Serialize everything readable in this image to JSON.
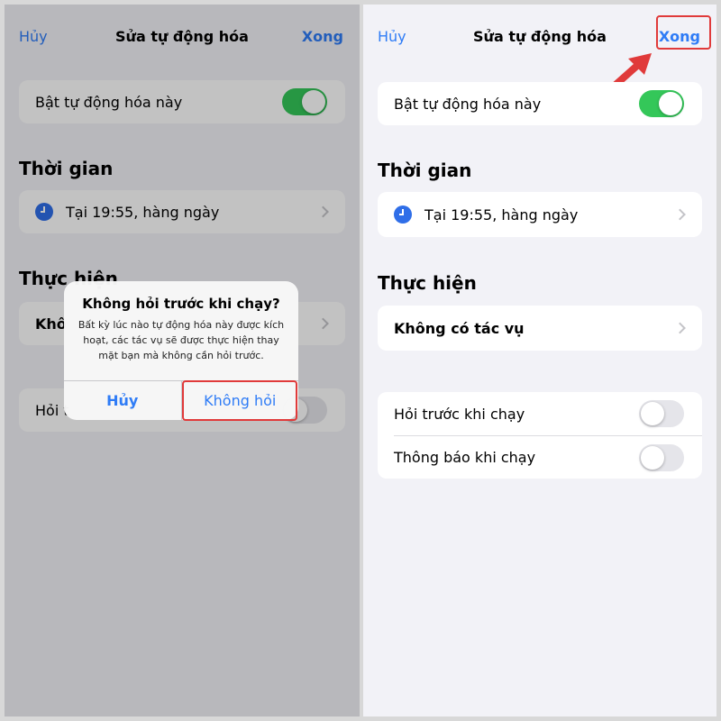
{
  "nav": {
    "cancel": "Hủy",
    "title": "Sửa tự động hóa",
    "done": "Xong"
  },
  "enable_row": {
    "label": "Bật tự động hóa này",
    "enabled": true
  },
  "time_section": {
    "title": "Thời gian",
    "trigger": "Tại 19:55, hàng ngày"
  },
  "action_section": {
    "title": "Thực hiện",
    "left_action_partial": "Khô",
    "no_action": "Không có tác vụ"
  },
  "options": {
    "ask_before_running": "Hỏi trước khi chạy",
    "ask_partial": "Hỏi t",
    "notify_when_run": "Thông báo khi chạy",
    "ask_enabled": false,
    "notify_enabled": false
  },
  "alert": {
    "title": "Không hỏi trước khi chạy?",
    "message": "Bất kỳ lúc nào tự động hóa này được kích hoạt, các tác vụ sẽ được thực hiện thay mặt bạn mà không cần hỏi trước.",
    "cancel": "Hủy",
    "confirm": "Không hỏi"
  },
  "colors": {
    "accent": "#2f7cf6",
    "toggle_on": "#34c759",
    "highlight": "#e03a3a"
  }
}
